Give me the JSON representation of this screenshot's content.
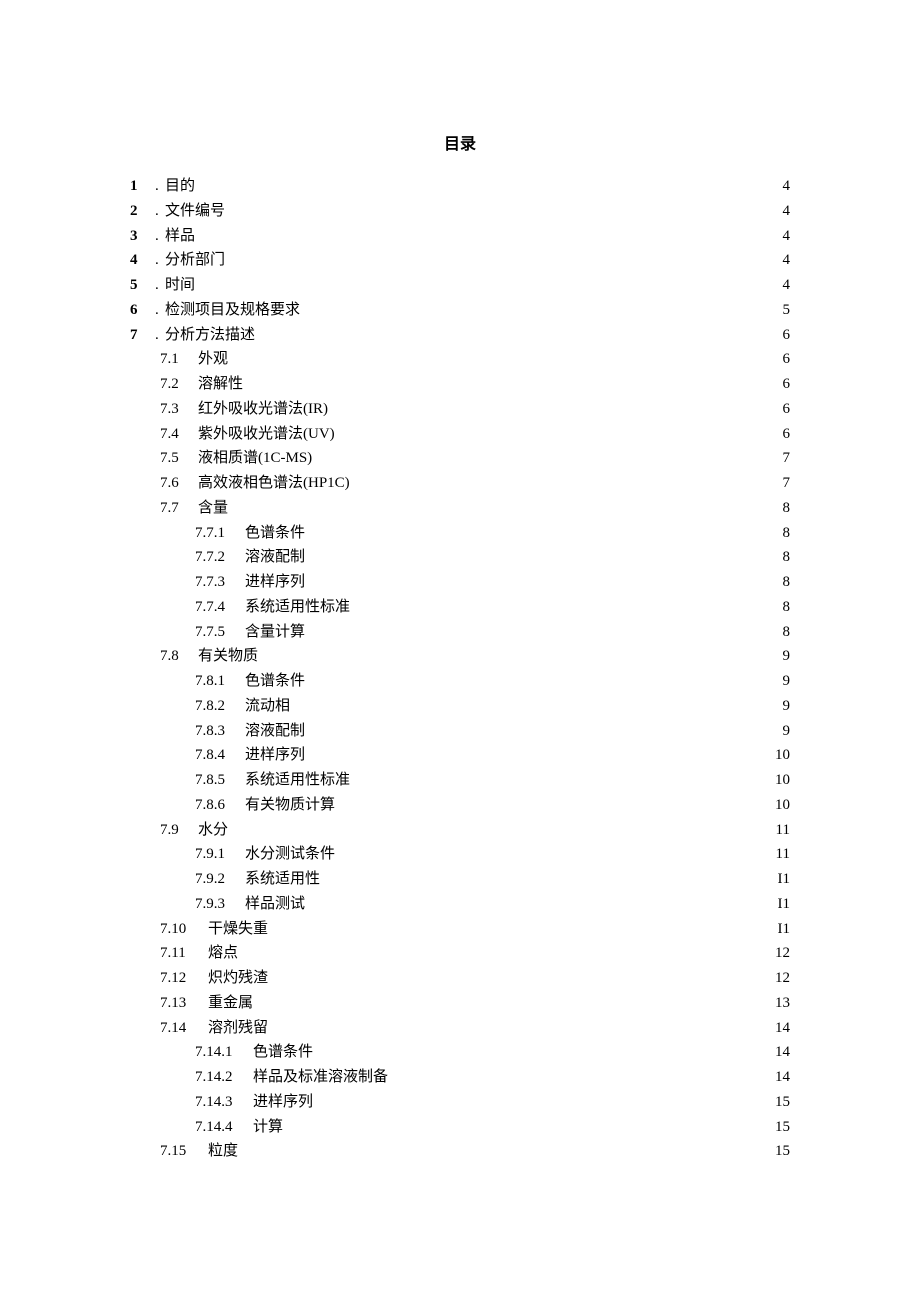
{
  "title": "目录",
  "toc": {
    "l1": [
      {
        "num": "1",
        "dot": ". ",
        "text": "目的",
        "page": "4"
      },
      {
        "num": "2",
        "dot": ".",
        "text": "文件编号",
        "page": "4"
      },
      {
        "num": "3",
        "dot": ".",
        "text": "样品",
        "page": "4"
      },
      {
        "num": "4",
        "dot": ".",
        "text": "分析部门",
        "page": "4"
      },
      {
        "num": "5",
        "dot": ".",
        "text": "时间",
        "page": "4"
      },
      {
        "num": "6",
        "dot": ".",
        "text": "检测项目及规格要求",
        "page": "5"
      },
      {
        "num": "7",
        "dot": ".",
        "text": "分析方法描述",
        "page": "6"
      }
    ],
    "l2a": [
      {
        "num": "7.1",
        "text": "外观",
        "page": "6"
      },
      {
        "num": "7.2",
        "text": "溶解性",
        "page": "6"
      },
      {
        "num": "7.3",
        "text": "红外吸收光谱法(IR)",
        "page": "6"
      },
      {
        "num": "7.4",
        "text": "紫外吸收光谱法(UV)",
        "page": "6"
      },
      {
        "num": "7.5",
        "text": "液相质谱(1C-MS)",
        "page": "7"
      },
      {
        "num": "7.6",
        "text": "高效液相色谱法(HP1C)",
        "page": "7"
      },
      {
        "num": "7.7",
        "text": "含量",
        "page": "8"
      }
    ],
    "l3_77": [
      {
        "num": "7.7.1",
        "text": "色谱条件",
        "page": "8"
      },
      {
        "num": "7.7.2",
        "text": "溶液配制",
        "page": "8"
      },
      {
        "num": "7.7.3",
        "text": "进样序列",
        "page": "8"
      },
      {
        "num": "7.7.4",
        "text": "系统适用性标准",
        "page": "8"
      },
      {
        "num": "7.7.5",
        "text": "含量计算",
        "page": "8"
      }
    ],
    "l2b": [
      {
        "num": "7.8",
        "text": "有关物质",
        "page": "9"
      }
    ],
    "l3_78": [
      {
        "num": "7.8.1",
        "text": "色谱条件",
        "page": "9"
      },
      {
        "num": "7.8.2",
        "text": "流动相",
        "page": "9"
      },
      {
        "num": "7.8.3",
        "text": "溶液配制",
        "page": "9"
      },
      {
        "num": "7.8.4",
        "text": "进样序列",
        "page": "10"
      },
      {
        "num": "7.8.5",
        "text": "系统适用性标准",
        "page": "10"
      },
      {
        "num": "7.8.6",
        "text": "有关物质计算",
        "page": "10"
      }
    ],
    "l2c": [
      {
        "num": "7.9",
        "text": "水分",
        "page": "11"
      }
    ],
    "l3_79": [
      {
        "num": "7.9.1",
        "text": "水分测试条件",
        "page": "11"
      },
      {
        "num": "7.9.2",
        "text": "系统适用性",
        "page": "I1"
      },
      {
        "num": "7.9.3",
        "text": "样品测试",
        "page": "I1"
      }
    ],
    "l2d": [
      {
        "num": "7.10",
        "text": "干燥失重",
        "page": "I1"
      },
      {
        "num": "7.11",
        "text": "熔点",
        "page": "12"
      },
      {
        "num": "7.12",
        "text": "炽灼残渣",
        "page": "12"
      },
      {
        "num": "7.13",
        "text": "重金属",
        "page": "13"
      },
      {
        "num": "7.14",
        "text": "溶剂残留",
        "page": "14"
      }
    ],
    "l3_714": [
      {
        "num": "7.14.1",
        "text": "色谱条件",
        "page": "14"
      },
      {
        "num": "7.14.2",
        "text": "样品及标准溶液制备",
        "page": "14"
      },
      {
        "num": "7.14.3",
        "text": "进样序列",
        "page": "15"
      },
      {
        "num": "7.14.4",
        "text": "计算",
        "page": "15"
      }
    ],
    "l2e": [
      {
        "num": "7.15",
        "text": "粒度",
        "page": "15"
      }
    ]
  }
}
